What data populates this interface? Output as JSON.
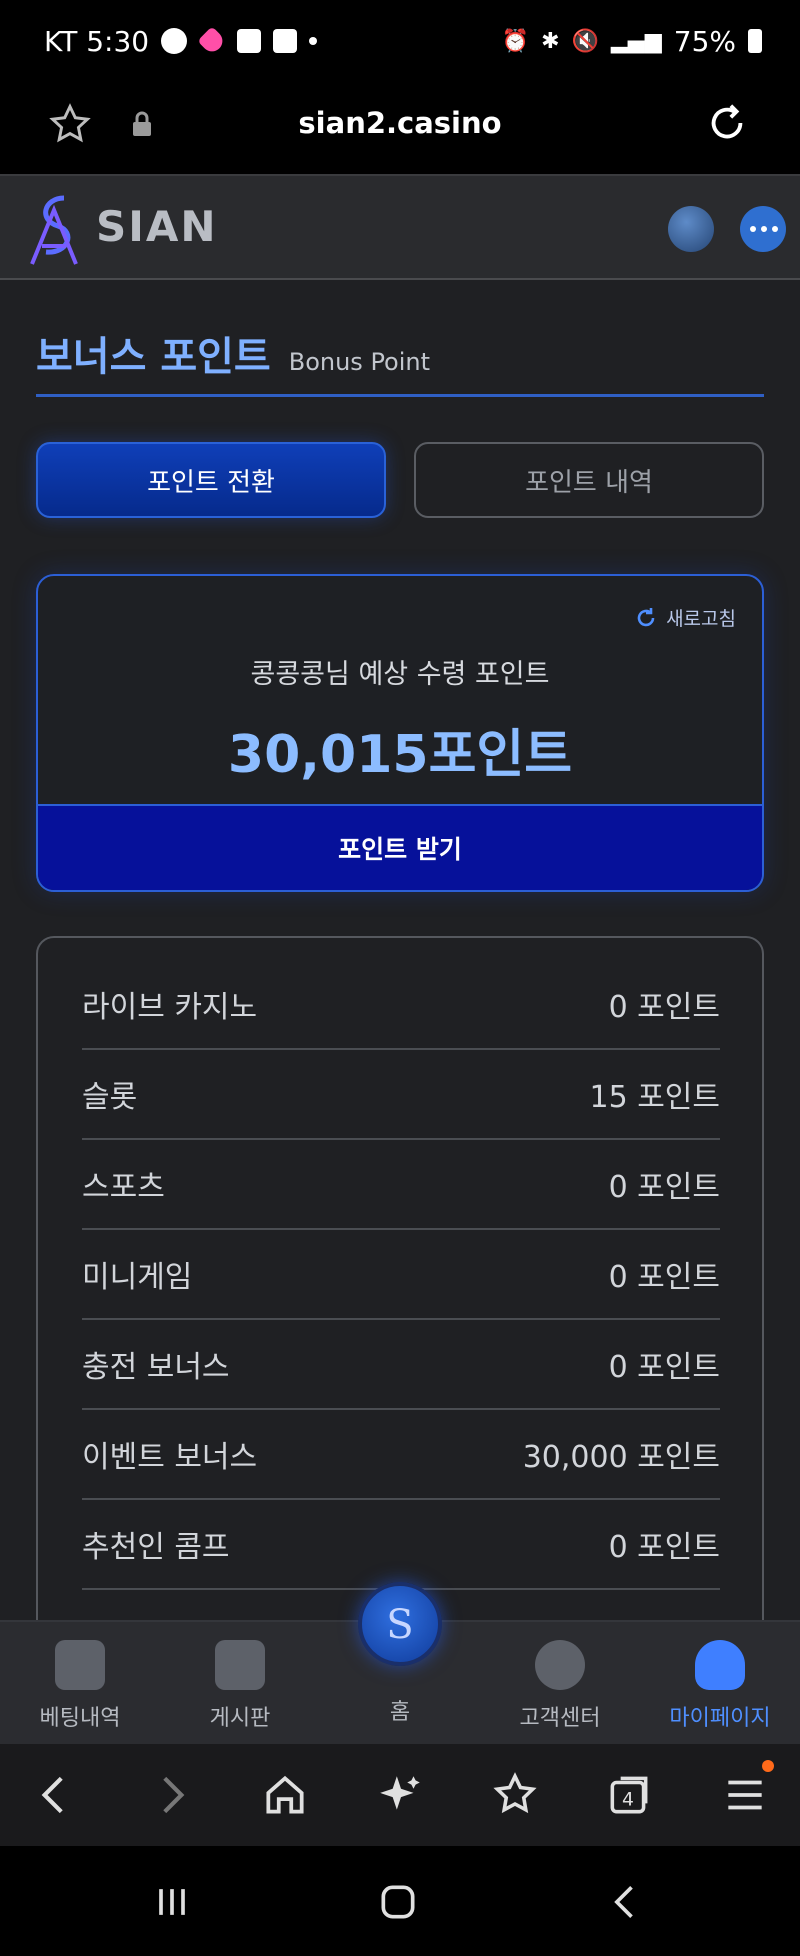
{
  "status_bar": {
    "carrier_time": "KT 5:30",
    "battery": "75%",
    "talk_badge": "TALK"
  },
  "browser": {
    "url": "sian2.casino"
  },
  "site": {
    "logo_text": "SIAN"
  },
  "page": {
    "title_ko": "보너스 포인트",
    "title_en": "Bonus Point"
  },
  "tabs": {
    "convert": "포인트 전환",
    "history": "포인트 내역"
  },
  "point_card": {
    "refresh_label": "새로고침",
    "expected_label": "콩콩콩님 예상 수령 포인트",
    "expected_value": "30,015포인트",
    "receive_button": "포인트 받기"
  },
  "breakdown": [
    {
      "label": "라이브 카지노",
      "value": "0 포인트"
    },
    {
      "label": "슬롯",
      "value": "15 포인트"
    },
    {
      "label": "스포츠",
      "value": "0 포인트"
    },
    {
      "label": "미니게임",
      "value": "0 포인트"
    },
    {
      "label": "충전 보너스",
      "value": "0 포인트"
    },
    {
      "label": "이벤트 보너스",
      "value": "30,000 포인트"
    },
    {
      "label": "추천인 콤프",
      "value": "0 포인트"
    }
  ],
  "bottom_nav": {
    "betting": "베팅내역",
    "board": "게시판",
    "home": "홈",
    "support": "고객센터",
    "mypage": "마이페이지"
  },
  "browser_toolbar": {
    "tab_count": "4"
  },
  "colors": {
    "accent": "#7fb0ff",
    "primary_button": "#06119a",
    "active_tab": "#0f3fb8",
    "nav_active": "#4f8fff"
  }
}
